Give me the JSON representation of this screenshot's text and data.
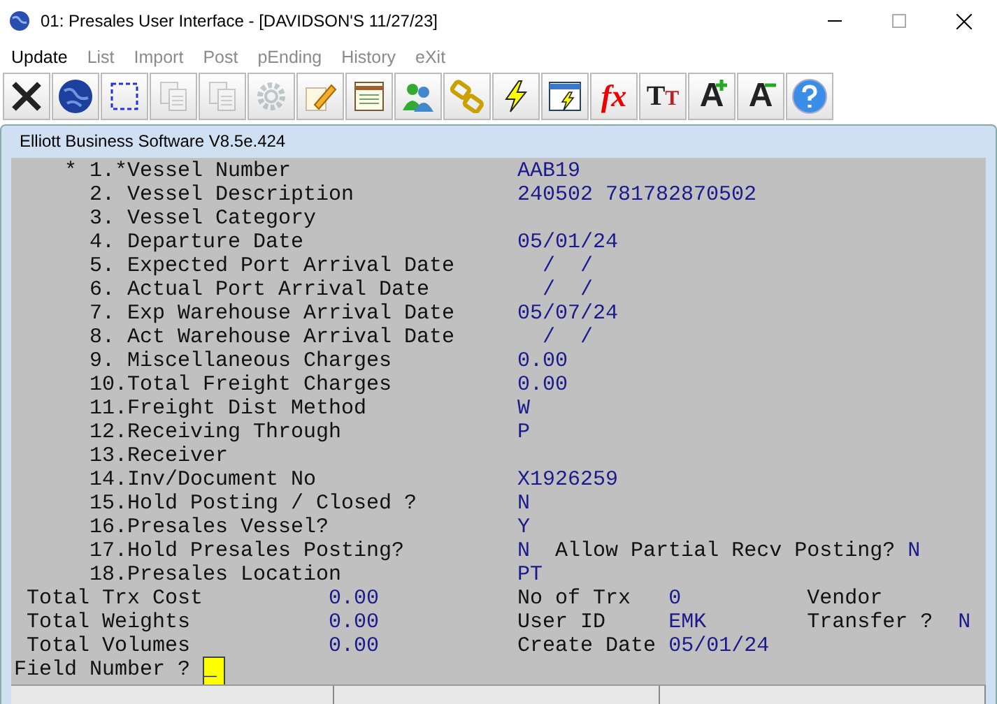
{
  "window": {
    "title": "01: Presales User Interface - [DAVIDSON'S 11/27/23]"
  },
  "menu": [
    {
      "label": "Update",
      "disabled": false
    },
    {
      "label": "List",
      "disabled": true
    },
    {
      "label": "Import",
      "disabled": true
    },
    {
      "label": "Post",
      "disabled": true
    },
    {
      "label": "pEnding",
      "disabled": true
    },
    {
      "label": "History",
      "disabled": true
    },
    {
      "label": "eXit",
      "disabled": true
    }
  ],
  "toolbar": [
    {
      "disabled": false
    },
    {
      "disabled": false
    },
    {
      "disabled": false
    },
    {
      "disabled": true
    },
    {
      "disabled": true
    },
    {
      "disabled": true
    },
    {
      "disabled": false
    },
    {
      "disabled": false
    },
    {
      "disabled": false
    },
    {
      "disabled": false
    },
    {
      "disabled": false
    },
    {
      "disabled": false
    },
    {
      "disabled": false,
      "glyph": "fx"
    },
    {
      "disabled": false,
      "glyph": "T",
      "glyph_2": "T"
    },
    {
      "disabled": false,
      "glyph": "A"
    },
    {
      "disabled": false,
      "glyph": "A"
    },
    {
      "disabled": false
    }
  ],
  "inner_window": {
    "title": "Elliott Business Software V8.5e.424"
  },
  "fields": [
    {
      "cursor_mark": "*",
      "number": "1.",
      "required_mark": "*",
      "label": "Vessel Number",
      "value": "AAB19"
    },
    {
      "number": "2.",
      "label": "Vessel Description",
      "value": "240502 781782870502"
    },
    {
      "number": "3.",
      "label": "Vessel Category"
    },
    {
      "number": "4.",
      "label": "Departure Date",
      "value": "05/01/24"
    },
    {
      "number": "5.",
      "label": "Expected Port Arrival Date",
      "value": "  /  /"
    },
    {
      "number": "6.",
      "label": "Actual Port Arrival Date",
      "value": "  /  /"
    },
    {
      "number": "7.",
      "label": "Exp Warehouse Arrival Date",
      "value": "05/07/24"
    },
    {
      "number": "8.",
      "label": "Act Warehouse Arrival Date",
      "value": "  /  /"
    },
    {
      "number": "9.",
      "label": "Miscellaneous Charges",
      "value": "0.00"
    },
    {
      "number": "10.",
      "label": "Total Freight Charges",
      "value": "0.00"
    },
    {
      "number": "11.",
      "label": "Freight Dist Method",
      "value": "W"
    },
    {
      "number": "12.",
      "label": "Receiving Through",
      "value": "P"
    },
    {
      "number": "13.",
      "label": "Receiver"
    },
    {
      "number": "14.",
      "label": "Inv/Document No",
      "value": "X1926259"
    },
    {
      "number": "15.",
      "label": "Hold Posting / Closed ?",
      "value": "N"
    },
    {
      "number": "16.",
      "label": "Presales Vessel?",
      "value": "Y"
    },
    {
      "number": "17.",
      "label": "Hold Presales Posting?",
      "value": "N",
      "extra_label": "Allow Partial Recv Posting?",
      "extra_value": "N"
    },
    {
      "number": "18.",
      "label": "Presales Location",
      "value": "PT"
    }
  ],
  "totals": [
    {
      "label": "Total Trx Cost",
      "value": "0.00",
      "label_2": "No of Trx",
      "value_2": "0",
      "label_3": "Vendor"
    },
    {
      "label": "Total Weights",
      "value": "0.00",
      "label_2": "User ID",
      "value_2": "EMK",
      "label_3": "Transfer ?",
      "value_3": "N"
    },
    {
      "label": "Total Volumes",
      "value": "0.00",
      "label_2": "Create Date",
      "value_2": "05/01/24"
    }
  ],
  "prompt": {
    "label": "Field Number ?",
    "value": "_"
  }
}
